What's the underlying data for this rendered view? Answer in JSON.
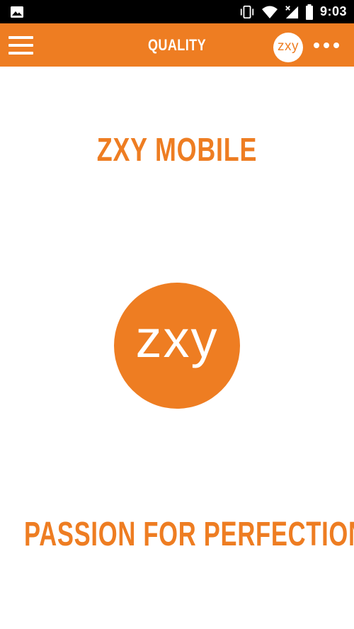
{
  "status_bar": {
    "time": "9:03",
    "icons": [
      "image-icon",
      "vibrate-icon",
      "wifi-icon",
      "signal-icon",
      "battery-icon"
    ]
  },
  "toolbar": {
    "title": "QUALITY",
    "logo_text": "zxy",
    "menu_icon": "hamburger-menu-icon",
    "overflow_icon": "more-dots-icon"
  },
  "main": {
    "heading": "ZXY MOBILE",
    "logo_text": "zxy",
    "tagline": "PASSION FOR PERFECTION"
  },
  "colors": {
    "brand": "#ee7d22",
    "status_bar": "#000000",
    "background": "#ffffff"
  }
}
